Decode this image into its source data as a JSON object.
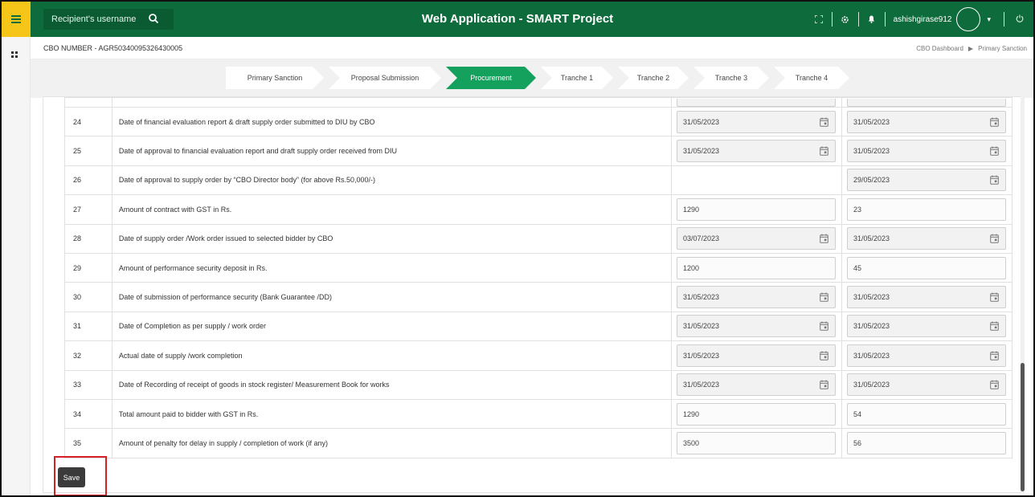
{
  "topbar": {
    "search_placeholder": "Recipient's username",
    "app_title": "Web Application - SMART Project",
    "username": "ashishgirase912"
  },
  "header": {
    "cbo_number": "CBO NUMBER - AGR50340095326430005",
    "breadcrumb": [
      "CBO Dashboard",
      "Primary Sanction"
    ]
  },
  "steps": [
    {
      "label": "Primary Sanction",
      "active": false
    },
    {
      "label": "Proposal Submission",
      "active": false
    },
    {
      "label": "Procurement",
      "active": true
    },
    {
      "label": "Tranche 1",
      "active": false
    },
    {
      "label": "Tranche 2",
      "active": false
    },
    {
      "label": "Tranche 3",
      "active": false
    },
    {
      "label": "Tranche 4",
      "active": false
    }
  ],
  "rows": [
    {
      "no": "24",
      "desc": "Date of financial evaluation report & draft supply order submitted to DIU by CBO",
      "v1": "31/05/2023",
      "v2": "31/05/2023"
    },
    {
      "no": "25",
      "desc": "Date of approval to financial evaluation report and draft supply order received from DIU",
      "v1": "31/05/2023",
      "v2": "31/05/2023"
    },
    {
      "no": "26",
      "desc": "Date of approval to supply order by “CBO Director body” (for above Rs.50,000/-)",
      "v1": null,
      "v2": "29/05/2023"
    },
    {
      "no": "27",
      "desc": "Amount of contract with GST in Rs.",
      "v1": "1290",
      "v2": "23"
    },
    {
      "no": "28",
      "desc": "Date of supply order /Work order issued to selected bidder by CBO",
      "v1": "03/07/2023",
      "v2": "31/05/2023"
    },
    {
      "no": "29",
      "desc": "Amount of performance security deposit in Rs.",
      "v1": "1200",
      "v2": "45"
    },
    {
      "no": "30",
      "desc": "Date of submission of performance security (Bank Guarantee /DD)",
      "v1": "31/05/2023",
      "v2": "31/05/2023"
    },
    {
      "no": "31",
      "desc": "Date of Completion as per supply / work order",
      "v1": "31/05/2023",
      "v2": "31/05/2023"
    },
    {
      "no": "32",
      "desc": "Actual date of supply /work completion",
      "v1": "31/05/2023",
      "v2": "31/05/2023"
    },
    {
      "no": "33",
      "desc": "Date of Recording of receipt of goods in stock register/ Measurement Book for works",
      "v1": "31/05/2023",
      "v2": "31/05/2023"
    },
    {
      "no": "34",
      "desc": "Total amount paid to bidder with GST in Rs.",
      "v1": "1290",
      "v2": "54"
    },
    {
      "no": "35",
      "desc": "Amount of penalty for delay in supply / completion of work (if any)",
      "v1": "3500",
      "v2": "56"
    }
  ],
  "actions": {
    "save_label": "Save"
  },
  "colors": {
    "topbar": "#0d6b3c",
    "menu": "#f5c518",
    "active_step": "#13a15d",
    "save_highlight": "#d61f26"
  }
}
